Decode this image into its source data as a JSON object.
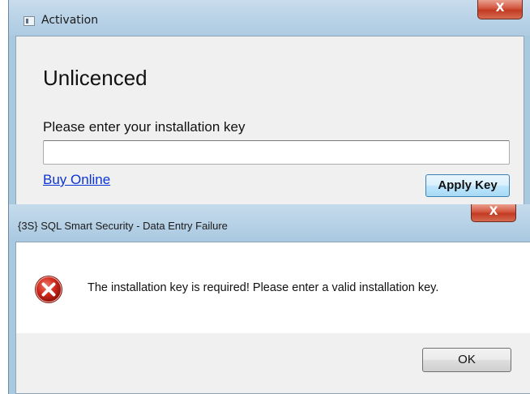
{
  "activation_window": {
    "title": "Activation",
    "close_label": "X",
    "heading": "Unlicenced",
    "prompt": "Please enter your installation key",
    "key_input": {
      "value": "",
      "placeholder": ""
    },
    "buy_link": "Buy Online",
    "apply_button": "Apply Key"
  },
  "error_dialog": {
    "title": "{3S} SQL Smart Security - Data Entry Failure",
    "close_label": "X",
    "message": "The installation key is required! Please enter a valid installation key.",
    "icon": "error-icon",
    "ok_button": "OK"
  },
  "colors": {
    "title_bar": "#b7d1e6",
    "close_button": "#c23a22",
    "link": "#0b34d6",
    "error_icon": "#c81e1e"
  }
}
